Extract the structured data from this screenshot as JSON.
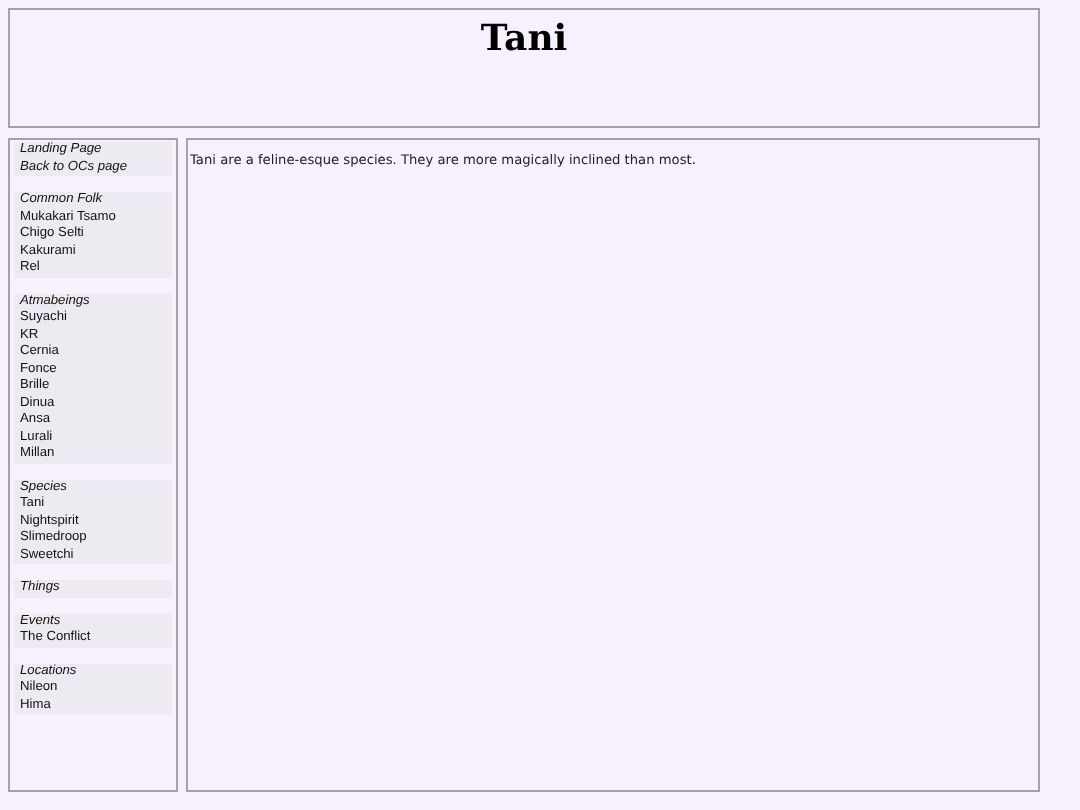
{
  "header": {
    "title": "Tani"
  },
  "sidebar": {
    "groups": [
      {
        "entries": [
          {
            "kind": "heading",
            "label": "Landing Page"
          },
          {
            "kind": "heading",
            "label": "Back to OCs page"
          }
        ]
      },
      {
        "entries": [
          {
            "kind": "heading",
            "label": "Common Folk"
          },
          {
            "kind": "link",
            "label": "Mukakari Tsamo"
          },
          {
            "kind": "link",
            "label": "Chigo Selti"
          },
          {
            "kind": "link",
            "label": "Kakurami"
          },
          {
            "kind": "link",
            "label": "Rel"
          }
        ]
      },
      {
        "entries": [
          {
            "kind": "heading",
            "label": "Atmabeings"
          },
          {
            "kind": "link",
            "label": "Suyachi"
          },
          {
            "kind": "link",
            "label": "KR"
          },
          {
            "kind": "link",
            "label": "Cernia"
          },
          {
            "kind": "link",
            "label": "Fonce"
          },
          {
            "kind": "link",
            "label": "Brille"
          },
          {
            "kind": "link",
            "label": "Dinua"
          },
          {
            "kind": "link",
            "label": "Ansa"
          },
          {
            "kind": "link",
            "label": "Lurali"
          },
          {
            "kind": "link",
            "label": "Millan"
          }
        ]
      },
      {
        "entries": [
          {
            "kind": "heading",
            "label": "Species"
          },
          {
            "kind": "link",
            "label": "Tani"
          },
          {
            "kind": "link",
            "label": "Nightspirit"
          },
          {
            "kind": "link",
            "label": "Slimedroop"
          },
          {
            "kind": "link",
            "label": "Sweetchi"
          }
        ]
      },
      {
        "entries": [
          {
            "kind": "heading",
            "label": "Things"
          }
        ]
      },
      {
        "entries": [
          {
            "kind": "heading",
            "label": "Events"
          },
          {
            "kind": "link",
            "label": "The Conflict"
          }
        ]
      },
      {
        "entries": [
          {
            "kind": "heading",
            "label": "Locations"
          },
          {
            "kind": "link",
            "label": "Nileon"
          },
          {
            "kind": "link",
            "label": "Hima"
          }
        ]
      }
    ]
  },
  "main": {
    "text": "Tani are a feline-esque species. They are more magically inclined than most."
  }
}
